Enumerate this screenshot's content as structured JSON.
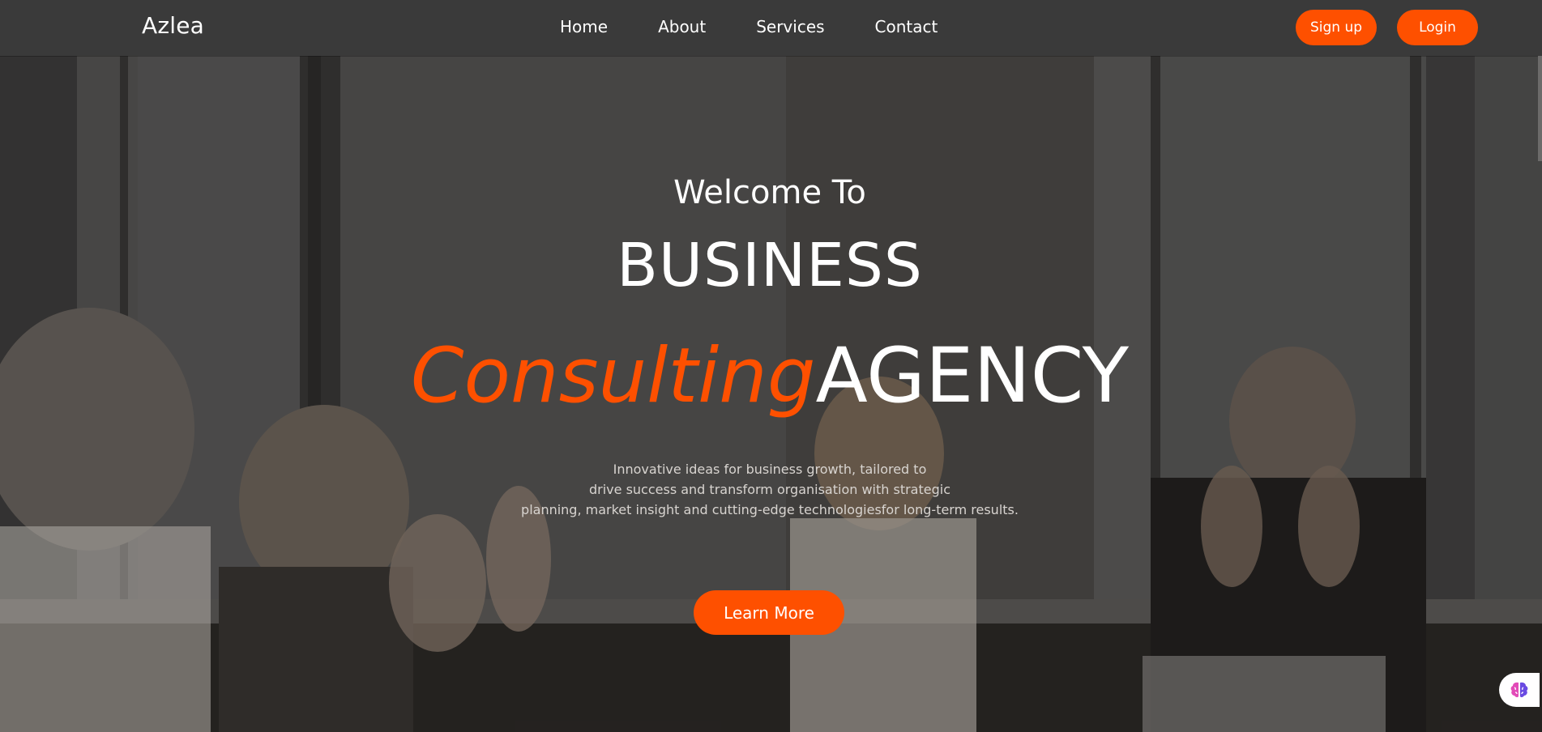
{
  "navbar": {
    "brand": "Azlea",
    "links": [
      "Home",
      "About",
      "Services",
      "Contact"
    ],
    "signup_label": "Sign up",
    "login_label": "Login"
  },
  "hero": {
    "welcome": "Welcome To",
    "business": "BUSINESS",
    "headline_accent": "Consulting",
    "headline_rest": "AGENCY",
    "tagline_lines": [
      "Innovative ideas for business growth, tailored to",
      "drive success and transform organisation with strategic",
      "planning, market insight and cutting-edge technologiesfor long-term results."
    ],
    "cta_label": "Learn More"
  },
  "colors": {
    "accent": "#fe5000",
    "nav_background": "#3a3a3a",
    "text": "#ffffff"
  },
  "icons": {
    "assistant": "brain-icon"
  }
}
